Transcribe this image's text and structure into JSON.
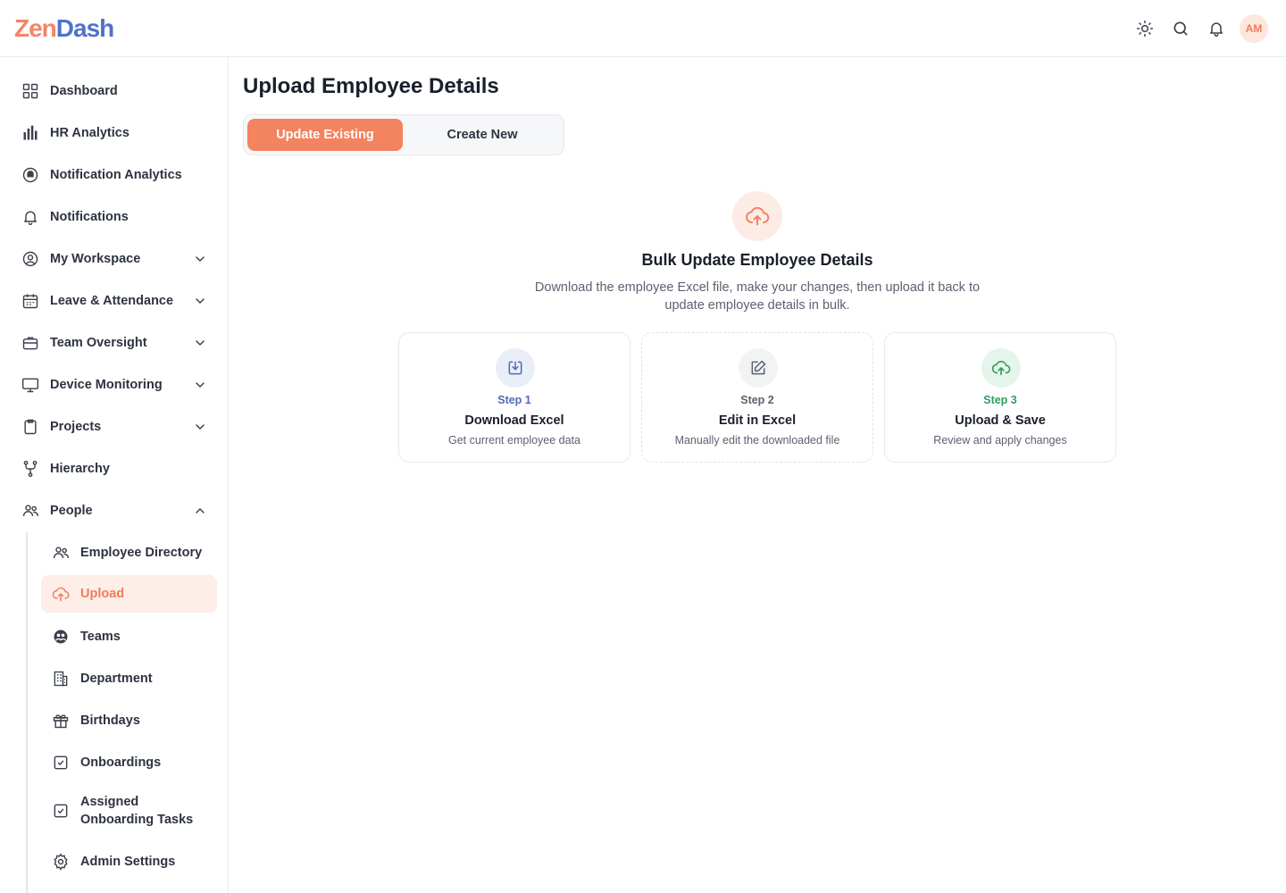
{
  "header": {
    "logo_part1": "Zen",
    "logo_part2": "Dash",
    "avatar_initials": "AM"
  },
  "sidebar": {
    "items": [
      {
        "label": "Dashboard"
      },
      {
        "label": "HR Analytics"
      },
      {
        "label": "Notification Analytics"
      },
      {
        "label": "Notifications"
      },
      {
        "label": "My Workspace"
      },
      {
        "label": "Leave & Attendance"
      },
      {
        "label": "Team Oversight"
      },
      {
        "label": "Device Monitoring"
      },
      {
        "label": "Projects"
      },
      {
        "label": "Hierarchy"
      },
      {
        "label": "People"
      }
    ],
    "sub_items": [
      {
        "label": "Employee Directory"
      },
      {
        "label": "Upload"
      },
      {
        "label": "Teams"
      },
      {
        "label": "Department"
      },
      {
        "label": "Birthdays"
      },
      {
        "label": "Onboardings"
      },
      {
        "label": "Assigned Onboarding Tasks"
      },
      {
        "label": "Admin Settings"
      }
    ]
  },
  "main": {
    "title": "Upload Employee Details",
    "tabs": [
      {
        "label": "Update Existing"
      },
      {
        "label": "Create New"
      }
    ],
    "hero_title": "Bulk Update Employee Details",
    "hero_desc": "Download the employee Excel file, make your changes, then upload it back to update employee details in bulk.",
    "steps": [
      {
        "step": "Step 1",
        "title": "Download Excel",
        "desc": "Get current employee data",
        "color": "#4e6bb8"
      },
      {
        "step": "Step 2",
        "title": "Edit in Excel",
        "desc": "Manually edit the downloaded file",
        "color": "#5b6170"
      },
      {
        "step": "Step 3",
        "title": "Upload & Save",
        "desc": "Review and apply changes",
        "color": "#2f9e5e"
      }
    ]
  },
  "colors": {
    "accent": "#f4835f",
    "accent_light": "#fdeee8",
    "blue": "#4e6bb8",
    "green": "#2f9e5e"
  }
}
